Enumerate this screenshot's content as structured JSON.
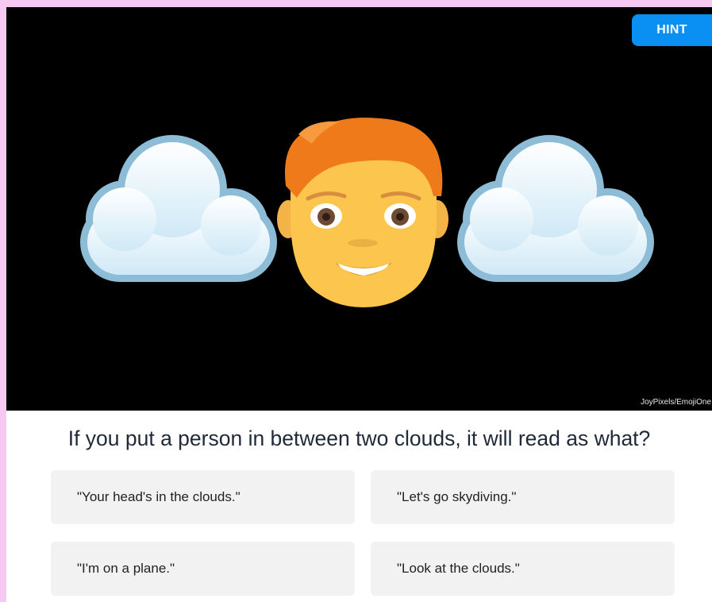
{
  "quiz": {
    "hint_label": "HINT",
    "image_credit": "JoyPixels/EmojiOne",
    "question": "If you put a person in between two clouds, it will read as what?",
    "icons": [
      "cloud-icon",
      "man-face-icon",
      "cloud-icon"
    ],
    "answers": [
      "\"Your head's in the clouds.\"",
      "\"Let's go skydiving.\"",
      "\"I'm on a plane.\"",
      "\"Look at the clouds.\""
    ]
  },
  "colors": {
    "page_background": "#f7c9f2",
    "media_background": "#000000",
    "hint_button": "#0a8ff2",
    "answer_background": "#f2f2f2",
    "question_text": "#1f2937"
  }
}
